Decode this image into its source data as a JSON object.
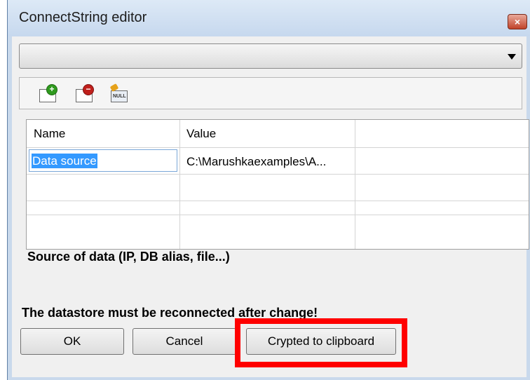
{
  "window": {
    "title": "ConnectString editor",
    "close_glyph": "×"
  },
  "combo": {
    "value": ""
  },
  "toolbar": {
    "add_glyph": "+",
    "remove_glyph": "−",
    "null_label": "NULL",
    "icons": [
      "add-row-icon",
      "remove-row-icon",
      "set-null-icon"
    ]
  },
  "grid": {
    "columns": [
      "Name",
      "Value",
      ""
    ],
    "rows": [
      {
        "name": "Data source",
        "value": "C:\\Marushkaexamples\\A..."
      },
      {
        "name": "",
        "value": ""
      }
    ]
  },
  "description": "Source of data (IP, DB alias, file...)",
  "warning": "The datastore must be reconnected after change!",
  "buttons": {
    "ok": "OK",
    "cancel": "Cancel",
    "crypted": "Crypted to clipboard"
  },
  "colors": {
    "highlight": "#ff0000",
    "selection": "#3399ff"
  }
}
